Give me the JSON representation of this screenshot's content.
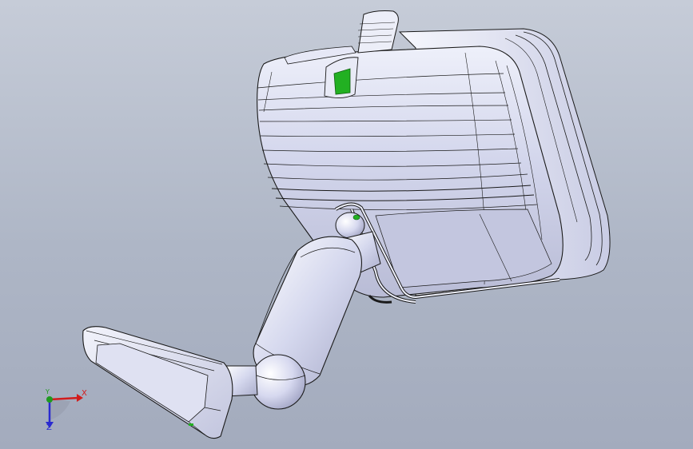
{
  "viewport": {
    "title": "",
    "background_top": "#c6ccd8",
    "background_bottom": "#a3abbd"
  },
  "model": {
    "description_icon": "mirror-assembly-3d-model",
    "highlight_color": "#22b022",
    "edge_color": "#1a1a1a",
    "face_color": "#d4d6ec"
  },
  "triad": {
    "x_label": "X",
    "y_label": "Y",
    "z_label": "Z",
    "x_color": "#d21c1c",
    "y_color": "#1f9a1f",
    "z_color": "#2a2ad0"
  }
}
